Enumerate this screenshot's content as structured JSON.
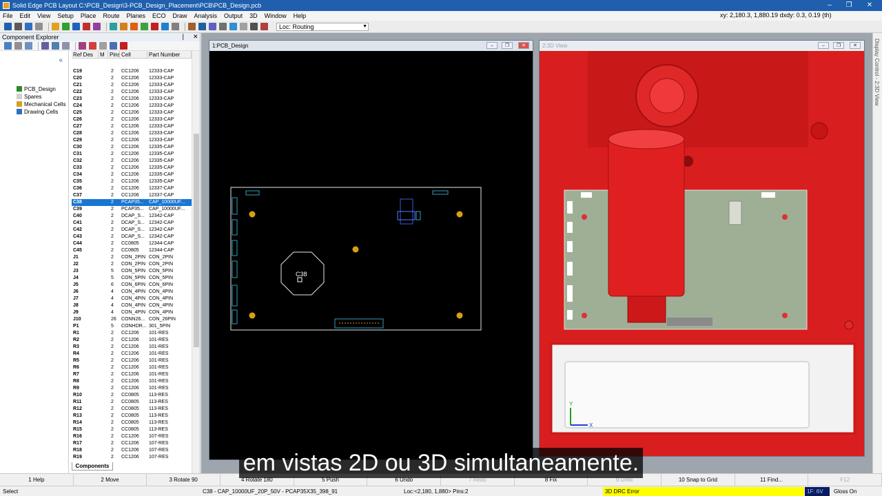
{
  "window": {
    "title": "Solid Edge PCB Layout  C:\\PCB_Design\\3-PCB_Design_Placement\\PCB\\PCB_Design.pcb",
    "minimize": "–",
    "maximize": "❐",
    "close": "✕"
  },
  "menu": {
    "items": [
      "File",
      "Edit",
      "View",
      "Setup",
      "Place",
      "Route",
      "Planes",
      "ECO",
      "Draw",
      "Analysis",
      "Output",
      "3D",
      "Window",
      "Help"
    ],
    "coords": "xy: 2,180.3, 1,880.19  dxdy: 0.3, 0.19  (th)"
  },
  "toolbar": {
    "loc_value": "Loc: Routing",
    "icon_colors": [
      "#1f5fae",
      "#5a5a5a",
      "#3070c0",
      "#909090",
      "#e0a020",
      "#30a030",
      "#2060c0",
      "#c03030",
      "#9040a0",
      "#2aa0a0",
      "#d08020",
      "#e06010",
      "#40a040",
      "#c02020",
      "#2080d0",
      "#808080",
      "#a06030",
      "#2060a0",
      "#6060c0",
      "#707070",
      "#3090d0",
      "#a0a0a0",
      "#505050",
      "#b04040"
    ]
  },
  "explorer": {
    "title": "Component Explorer",
    "pin": "❘",
    "close": "✕",
    "collapse": "«",
    "tree": [
      {
        "label": "PCB_Design",
        "color": "#2a8a2a"
      },
      {
        "label": "Spares",
        "color": "#d0d0d0"
      },
      {
        "label": "Mechanical Cells",
        "color": "#d8a020"
      },
      {
        "label": "Drawing Cells",
        "color": "#3070c0"
      }
    ],
    "columns": [
      "Ref Des",
      "M",
      "Pins",
      "Cell",
      "Part Number"
    ],
    "rows": [
      [
        "C19",
        "",
        "2",
        "CC1206",
        "12333-CAP"
      ],
      [
        "C20",
        "",
        "2",
        "CC1206",
        "12333-CAP"
      ],
      [
        "C21",
        "",
        "2",
        "CC1206",
        "12333-CAP"
      ],
      [
        "C22",
        "",
        "2",
        "CC1206",
        "12333-CAP"
      ],
      [
        "C23",
        "",
        "2",
        "CC1206",
        "12333-CAP"
      ],
      [
        "C24",
        "",
        "2",
        "CC1206",
        "12333-CAP"
      ],
      [
        "C25",
        "",
        "2",
        "CC1206",
        "12333-CAP"
      ],
      [
        "C26",
        "",
        "2",
        "CC1206",
        "12333-CAP"
      ],
      [
        "C27",
        "",
        "2",
        "CC1206",
        "12333-CAP"
      ],
      [
        "C28",
        "",
        "2",
        "CC1206",
        "12333-CAP"
      ],
      [
        "C29",
        "",
        "2",
        "CC1206",
        "12333-CAP"
      ],
      [
        "C30",
        "",
        "2",
        "CC1206",
        "12335-CAP"
      ],
      [
        "C31",
        "",
        "2",
        "CC1206",
        "12335-CAP"
      ],
      [
        "C32",
        "",
        "2",
        "CC1206",
        "12335-CAP"
      ],
      [
        "C33",
        "",
        "2",
        "CC1206",
        "12335-CAP"
      ],
      [
        "C34",
        "",
        "2",
        "CC1206",
        "12335-CAP"
      ],
      [
        "C35",
        "",
        "2",
        "CC1206",
        "12335-CAP"
      ],
      [
        "C36",
        "",
        "2",
        "CC1206",
        "12337-CAP"
      ],
      [
        "C37",
        "",
        "2",
        "CC1206",
        "12337-CAP"
      ],
      [
        "C38",
        "",
        "2",
        "PCAP35...",
        "CAP_10000UF..."
      ],
      [
        "C39",
        "",
        "2",
        "PCAP35...",
        "CAP_10000UF..."
      ],
      [
        "C40",
        "",
        "2",
        "DCAP_S...",
        "12342-CAP"
      ],
      [
        "C41",
        "",
        "2",
        "DCAP_S...",
        "12342-CAP"
      ],
      [
        "C42",
        "",
        "2",
        "DCAP_S...",
        "12342-CAP"
      ],
      [
        "C43",
        "",
        "2",
        "DCAP_S...",
        "12342-CAP"
      ],
      [
        "C44",
        "",
        "2",
        "CC0805",
        "12344-CAP"
      ],
      [
        "C45",
        "",
        "2",
        "CC0805",
        "12344-CAP"
      ],
      [
        "J1",
        "",
        "2",
        "CON_2PIN",
        "CON_2PIN"
      ],
      [
        "J2",
        "",
        "2",
        "CON_2PIN",
        "CON_2PIN"
      ],
      [
        "J3",
        "",
        "5",
        "CON_5PIN",
        "CON_5PIN"
      ],
      [
        "J4",
        "",
        "5",
        "CON_5PIN",
        "CON_5PIN"
      ],
      [
        "J5",
        "",
        "6",
        "CON_6PIN",
        "CON_6PIN"
      ],
      [
        "J6",
        "",
        "4",
        "CON_4PIN",
        "CON_4PIN"
      ],
      [
        "J7",
        "",
        "4",
        "CON_4PIN",
        "CON_4PIN"
      ],
      [
        "J8",
        "",
        "4",
        "CON_4PIN",
        "CON_4PIN"
      ],
      [
        "J9",
        "",
        "4",
        "CON_4PIN",
        "CON_4PIN"
      ],
      [
        "J10",
        "",
        "26",
        "CONN26...",
        "CON_26PIN"
      ],
      [
        "P1",
        "",
        "5",
        "CONHDR...",
        "301_5PIN"
      ],
      [
        "R1",
        "",
        "2",
        "CC1206",
        "101-RES"
      ],
      [
        "R2",
        "",
        "2",
        "CC1206",
        "101-RES"
      ],
      [
        "R3",
        "",
        "2",
        "CC1206",
        "101-RES"
      ],
      [
        "R4",
        "",
        "2",
        "CC1206",
        "101-RES"
      ],
      [
        "R5",
        "",
        "2",
        "CC1206",
        "101-RES"
      ],
      [
        "R6",
        "",
        "2",
        "CC1206",
        "101-RES"
      ],
      [
        "R7",
        "",
        "2",
        "CC1206",
        "101-RES"
      ],
      [
        "R8",
        "",
        "2",
        "CC1206",
        "101-RES"
      ],
      [
        "R9",
        "",
        "2",
        "CC1206",
        "101-RES"
      ],
      [
        "R10",
        "",
        "2",
        "CC0805",
        "113-RES"
      ],
      [
        "R11",
        "",
        "2",
        "CC0805",
        "113-RES"
      ],
      [
        "R12",
        "",
        "2",
        "CC0805",
        "113-RES"
      ],
      [
        "R13",
        "",
        "2",
        "CC0805",
        "113-RES"
      ],
      [
        "R14",
        "",
        "2",
        "CC0805",
        "113-RES"
      ],
      [
        "R15",
        "",
        "2",
        "CC0805",
        "113-RES"
      ],
      [
        "R16",
        "",
        "2",
        "CC1206",
        "107-RES"
      ],
      [
        "R17",
        "",
        "2",
        "CC1206",
        "107-RES"
      ],
      [
        "R18",
        "",
        "2",
        "CC1206",
        "107-RES"
      ],
      [
        "R19",
        "",
        "2",
        "CC1206",
        "107-RES"
      ]
    ],
    "selected_ref": "C38",
    "tab": "Components"
  },
  "views": {
    "pcb_title": "1:PCB_Design",
    "view3d_title": "2:3D View",
    "selected_label": "C38",
    "axis_y": "Y",
    "axis_x": "X"
  },
  "side_panel": "Display Control - 2:3D View",
  "fkeys": [
    {
      "label": "1 Help",
      "enabled": true
    },
    {
      "label": "2 Move",
      "enabled": true
    },
    {
      "label": "3 Rotate 90",
      "enabled": true
    },
    {
      "label": "4 Rotate 180",
      "enabled": true
    },
    {
      "label": "5 Push",
      "enabled": true
    },
    {
      "label": "6 Undo",
      "enabled": true
    },
    {
      "label": "7 Redo",
      "enabled": false
    },
    {
      "label": "8 Fix",
      "enabled": true
    },
    {
      "label": "9 Unfix",
      "enabled": false
    },
    {
      "label": "10 Snap to Grid",
      "enabled": true
    },
    {
      "label": "11 Find...",
      "enabled": true
    },
    {
      "label": "F12",
      "enabled": false
    }
  ],
  "status": {
    "mode": "Select",
    "component": "C38 - CAP_10000UF_20P_50V - PCAP35X35_398_91",
    "location": "Loc:<2,180, 1,880> Pins:2",
    "drc": "3D DRC Error",
    "layer": "1F: 6V",
    "gloss": "Gloss On"
  },
  "caption": "em vistas 2D ou 3D simultaneamente."
}
